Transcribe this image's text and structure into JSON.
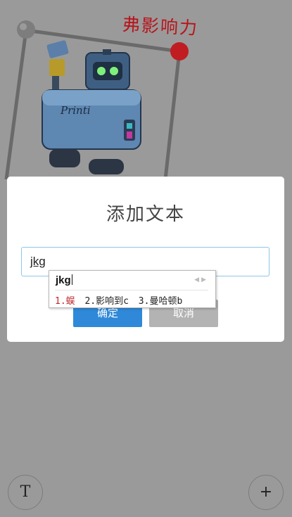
{
  "canvas": {
    "art_text": "弗影响力",
    "art_text_color": "#b8141b",
    "robot_label": "Printi"
  },
  "dialog": {
    "title": "添加文本",
    "input_value": "jkg",
    "confirm_label": "确定",
    "cancel_label": "取消",
    "accent_color": "#2f89d8"
  },
  "ime": {
    "composition": "jkg",
    "candidates": [
      "1.蜈",
      "2.影响到c",
      "3.曼哈顿b"
    ]
  },
  "toolbar": {
    "text_tool_label": "T",
    "add_label": "+"
  }
}
